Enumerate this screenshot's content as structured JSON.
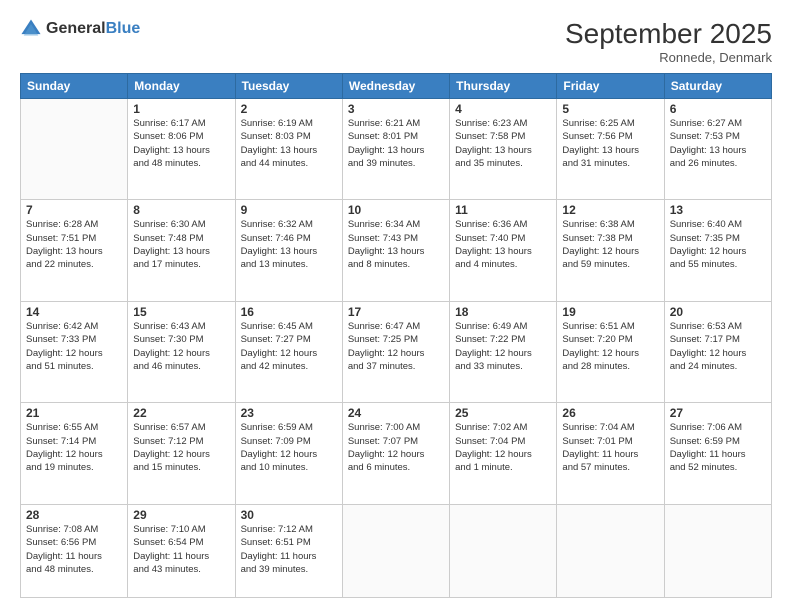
{
  "header": {
    "logo": {
      "general": "General",
      "blue": "Blue"
    },
    "title": "September 2025",
    "location": "Ronnede, Denmark"
  },
  "days_of_week": [
    "Sunday",
    "Monday",
    "Tuesday",
    "Wednesday",
    "Thursday",
    "Friday",
    "Saturday"
  ],
  "weeks": [
    [
      {
        "day": "",
        "info": ""
      },
      {
        "day": "1",
        "info": "Sunrise: 6:17 AM\nSunset: 8:06 PM\nDaylight: 13 hours\nand 48 minutes."
      },
      {
        "day": "2",
        "info": "Sunrise: 6:19 AM\nSunset: 8:03 PM\nDaylight: 13 hours\nand 44 minutes."
      },
      {
        "day": "3",
        "info": "Sunrise: 6:21 AM\nSunset: 8:01 PM\nDaylight: 13 hours\nand 39 minutes."
      },
      {
        "day": "4",
        "info": "Sunrise: 6:23 AM\nSunset: 7:58 PM\nDaylight: 13 hours\nand 35 minutes."
      },
      {
        "day": "5",
        "info": "Sunrise: 6:25 AM\nSunset: 7:56 PM\nDaylight: 13 hours\nand 31 minutes."
      },
      {
        "day": "6",
        "info": "Sunrise: 6:27 AM\nSunset: 7:53 PM\nDaylight: 13 hours\nand 26 minutes."
      }
    ],
    [
      {
        "day": "7",
        "info": "Sunrise: 6:28 AM\nSunset: 7:51 PM\nDaylight: 13 hours\nand 22 minutes."
      },
      {
        "day": "8",
        "info": "Sunrise: 6:30 AM\nSunset: 7:48 PM\nDaylight: 13 hours\nand 17 minutes."
      },
      {
        "day": "9",
        "info": "Sunrise: 6:32 AM\nSunset: 7:46 PM\nDaylight: 13 hours\nand 13 minutes."
      },
      {
        "day": "10",
        "info": "Sunrise: 6:34 AM\nSunset: 7:43 PM\nDaylight: 13 hours\nand 8 minutes."
      },
      {
        "day": "11",
        "info": "Sunrise: 6:36 AM\nSunset: 7:40 PM\nDaylight: 13 hours\nand 4 minutes."
      },
      {
        "day": "12",
        "info": "Sunrise: 6:38 AM\nSunset: 7:38 PM\nDaylight: 12 hours\nand 59 minutes."
      },
      {
        "day": "13",
        "info": "Sunrise: 6:40 AM\nSunset: 7:35 PM\nDaylight: 12 hours\nand 55 minutes."
      }
    ],
    [
      {
        "day": "14",
        "info": "Sunrise: 6:42 AM\nSunset: 7:33 PM\nDaylight: 12 hours\nand 51 minutes."
      },
      {
        "day": "15",
        "info": "Sunrise: 6:43 AM\nSunset: 7:30 PM\nDaylight: 12 hours\nand 46 minutes."
      },
      {
        "day": "16",
        "info": "Sunrise: 6:45 AM\nSunset: 7:27 PM\nDaylight: 12 hours\nand 42 minutes."
      },
      {
        "day": "17",
        "info": "Sunrise: 6:47 AM\nSunset: 7:25 PM\nDaylight: 12 hours\nand 37 minutes."
      },
      {
        "day": "18",
        "info": "Sunrise: 6:49 AM\nSunset: 7:22 PM\nDaylight: 12 hours\nand 33 minutes."
      },
      {
        "day": "19",
        "info": "Sunrise: 6:51 AM\nSunset: 7:20 PM\nDaylight: 12 hours\nand 28 minutes."
      },
      {
        "day": "20",
        "info": "Sunrise: 6:53 AM\nSunset: 7:17 PM\nDaylight: 12 hours\nand 24 minutes."
      }
    ],
    [
      {
        "day": "21",
        "info": "Sunrise: 6:55 AM\nSunset: 7:14 PM\nDaylight: 12 hours\nand 19 minutes."
      },
      {
        "day": "22",
        "info": "Sunrise: 6:57 AM\nSunset: 7:12 PM\nDaylight: 12 hours\nand 15 minutes."
      },
      {
        "day": "23",
        "info": "Sunrise: 6:59 AM\nSunset: 7:09 PM\nDaylight: 12 hours\nand 10 minutes."
      },
      {
        "day": "24",
        "info": "Sunrise: 7:00 AM\nSunset: 7:07 PM\nDaylight: 12 hours\nand 6 minutes."
      },
      {
        "day": "25",
        "info": "Sunrise: 7:02 AM\nSunset: 7:04 PM\nDaylight: 12 hours\nand 1 minute."
      },
      {
        "day": "26",
        "info": "Sunrise: 7:04 AM\nSunset: 7:01 PM\nDaylight: 11 hours\nand 57 minutes."
      },
      {
        "day": "27",
        "info": "Sunrise: 7:06 AM\nSunset: 6:59 PM\nDaylight: 11 hours\nand 52 minutes."
      }
    ],
    [
      {
        "day": "28",
        "info": "Sunrise: 7:08 AM\nSunset: 6:56 PM\nDaylight: 11 hours\nand 48 minutes."
      },
      {
        "day": "29",
        "info": "Sunrise: 7:10 AM\nSunset: 6:54 PM\nDaylight: 11 hours\nand 43 minutes."
      },
      {
        "day": "30",
        "info": "Sunrise: 7:12 AM\nSunset: 6:51 PM\nDaylight: 11 hours\nand 39 minutes."
      },
      {
        "day": "",
        "info": ""
      },
      {
        "day": "",
        "info": ""
      },
      {
        "day": "",
        "info": ""
      },
      {
        "day": "",
        "info": ""
      }
    ]
  ]
}
